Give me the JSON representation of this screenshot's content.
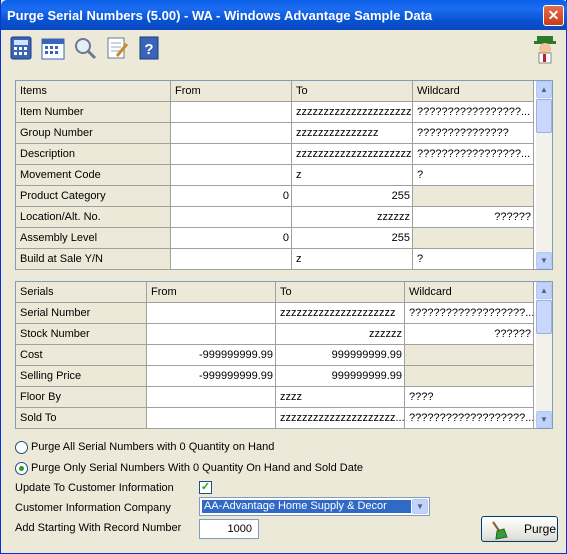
{
  "window": {
    "title": "Purge Serial Numbers (5.00) - WA - Windows Advantage Sample Data",
    "close_glyph": "✕"
  },
  "toolbar": {
    "buttons": [
      "calculator-icon",
      "calendar-icon",
      "magnifier-icon",
      "notepad-icon",
      "help-book-icon"
    ],
    "mascot": "mascot-icon"
  },
  "items_grid": {
    "headers": [
      "Items",
      "From",
      "To",
      "Wildcard"
    ],
    "rows": [
      [
        "Item Number",
        "",
        "zzzzzzzzzzzzzzzzzzzzz",
        "?????????????????..."
      ],
      [
        "Group Number",
        "",
        "zzzzzzzzzzzzzzz",
        "???????????????"
      ],
      [
        "Description",
        "",
        "zzzzzzzzzzzzzzzzzzzzz",
        "?????????????????..."
      ],
      [
        "Movement Code",
        "",
        "z",
        "?"
      ],
      [
        "Product Category",
        "0",
        "255",
        ""
      ],
      [
        "Location/Alt. No.",
        "",
        "zzzzzz",
        "??????"
      ],
      [
        "Assembly Level",
        "0",
        "255",
        ""
      ],
      [
        "Build at Sale Y/N",
        "",
        "z",
        "?"
      ]
    ]
  },
  "serials_grid": {
    "headers": [
      "Serials",
      "From",
      "To",
      "Wildcard"
    ],
    "rows": [
      [
        "Serial Number",
        "",
        "zzzzzzzzzzzzzzzzzzzzz",
        "???????????????????..."
      ],
      [
        "Stock Number",
        "",
        "zzzzzz",
        "??????"
      ],
      [
        "Cost",
        "-999999999.99",
        "999999999.99",
        ""
      ],
      [
        "Selling Price",
        "-999999999.99",
        "999999999.99",
        ""
      ],
      [
        "Floor By",
        "",
        "zzzz",
        "????"
      ],
      [
        "Sold To",
        "",
        "zzzzzzzzzzzzzzzzzzzzz...",
        "???????????????????..."
      ]
    ]
  },
  "options": {
    "radio1": "Purge All Serial Numbers with 0 Quantity on Hand",
    "radio2": "Purge Only Serial Numbers With 0 Quantity On Hand and Sold Date",
    "selected_radio": 2,
    "update_label": "Update To Customer Information",
    "update_checked": "✓",
    "company_label": "Customer Information Company",
    "company_value": "AA-Advantage Home Supply & Decor",
    "record_label": "Add Starting With Record Number",
    "record_value": "1000"
  },
  "purge_button": {
    "label": "Purge"
  }
}
